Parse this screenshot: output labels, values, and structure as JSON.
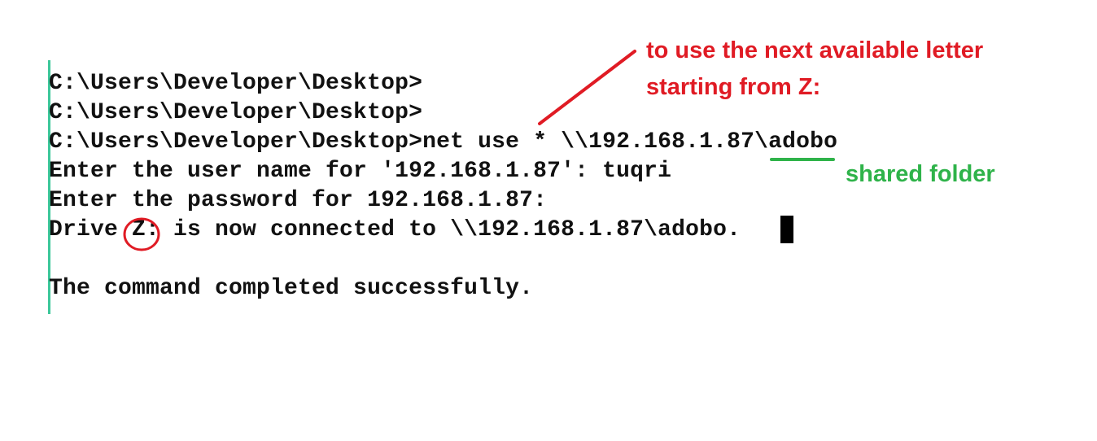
{
  "terminal": {
    "lines": [
      "C:\\Users\\Developer\\Desktop>",
      "C:\\Users\\Developer\\Desktop>",
      "C:\\Users\\Developer\\Desktop>net use * \\\\192.168.1.87\\adobo",
      "Enter the user name for '192.168.1.87': tuqri",
      "Enter the password for 192.168.1.87:",
      "Drive Z: is now connected to \\\\192.168.1.87\\adobo.",
      "",
      "The command completed successfully."
    ]
  },
  "annotations": {
    "next_letter_note": [
      "to use the next available letter",
      "starting from Z:"
    ],
    "shared_folder_note": "shared folder",
    "colors": {
      "red": "#e01b24",
      "green": "#2fb34a",
      "rule": "#3cc79a"
    }
  }
}
